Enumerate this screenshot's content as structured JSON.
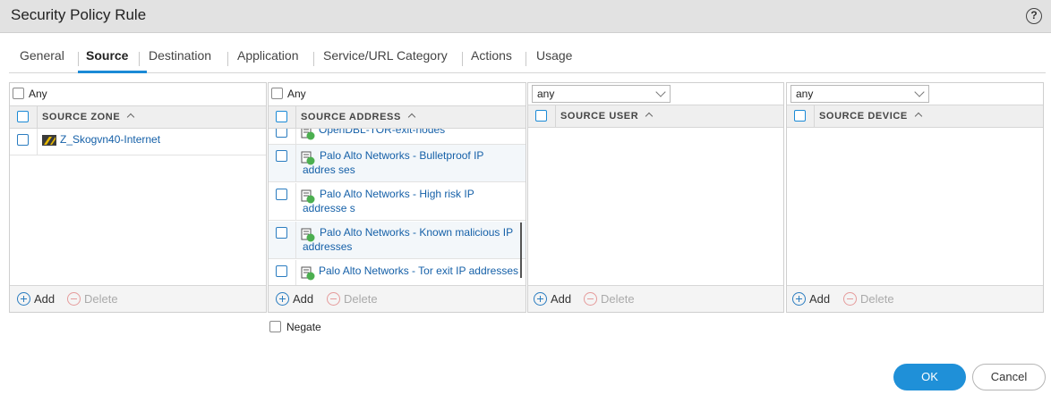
{
  "dialog": {
    "title": "Security Policy Rule",
    "help": "?"
  },
  "tabs": [
    {
      "label": "General"
    },
    {
      "label": "Source"
    },
    {
      "label": "Destination"
    },
    {
      "label": "Application"
    },
    {
      "label": "Service/URL Category"
    },
    {
      "label": "Actions"
    },
    {
      "label": "Usage"
    }
  ],
  "active_tab": "Source",
  "source_zone": {
    "any_label": "Any",
    "header": "SOURCE ZONE",
    "items": [
      {
        "label": "Z_Skogvn40-Internet",
        "icon": "zone-icon"
      }
    ],
    "add_label": "Add",
    "delete_label": "Delete"
  },
  "source_address": {
    "any_label": "Any",
    "header": "SOURCE ADDRESS",
    "items": [
      {
        "label": "OpenDBL-TOR-exit-nodes",
        "icon": "edl-icon"
      },
      {
        "label": "Palo Alto Networks - Bulletproof IP addres ses",
        "icon": "edl-icon"
      },
      {
        "label": "Palo Alto Networks - High risk IP addresse s",
        "icon": "edl-icon"
      },
      {
        "label": "Palo Alto Networks - Known malicious IP addresses",
        "icon": "edl-icon"
      },
      {
        "label": "Palo Alto Networks - Tor exit IP addresses",
        "icon": "edl-icon"
      }
    ],
    "add_label": "Add",
    "delete_label": "Delete",
    "negate_label": "Negate"
  },
  "source_user": {
    "select_value": "any",
    "header": "SOURCE USER",
    "add_label": "Add",
    "delete_label": "Delete"
  },
  "source_device": {
    "select_value": "any",
    "header": "SOURCE DEVICE",
    "add_label": "Add",
    "delete_label": "Delete"
  },
  "buttons": {
    "ok": "OK",
    "cancel": "Cancel"
  },
  "colors": {
    "accent": "#1f90d8",
    "link": "#1560a8",
    "header_bg": "#efefef"
  }
}
